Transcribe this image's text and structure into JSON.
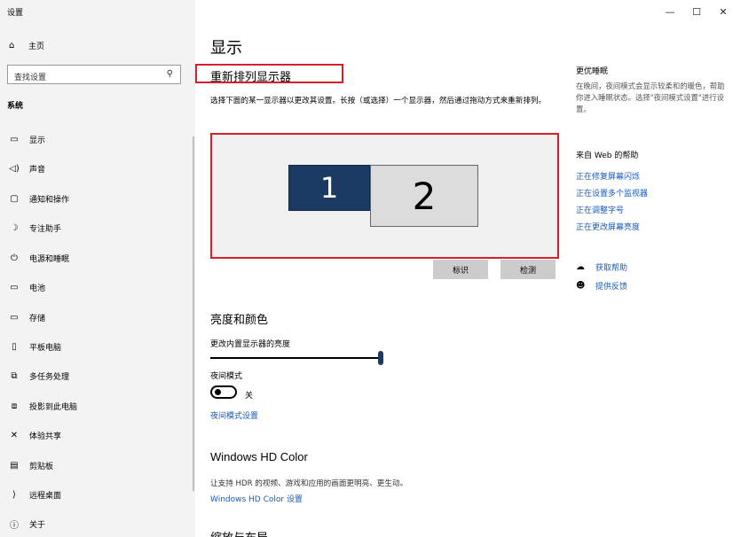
{
  "window": {
    "title": "设置",
    "min_icon": "minimize-icon",
    "max_icon": "maximize-icon",
    "close_icon": "close-icon"
  },
  "sidebar": {
    "home_label": "主页",
    "search_placeholder": "查找设置",
    "section_label": "系统",
    "items": [
      {
        "label": "显示",
        "icon": "monitor-icon"
      },
      {
        "label": "声音",
        "icon": "speaker-icon"
      },
      {
        "label": "通知和操作",
        "icon": "notification-icon"
      },
      {
        "label": "专注助手",
        "icon": "moon-icon"
      },
      {
        "label": "电源和睡眠",
        "icon": "power-icon"
      },
      {
        "label": "电池",
        "icon": "battery-icon"
      },
      {
        "label": "存储",
        "icon": "storage-icon"
      },
      {
        "label": "平板电脑",
        "icon": "tablet-icon"
      },
      {
        "label": "多任务处理",
        "icon": "multitask-icon"
      },
      {
        "label": "投影到此电脑",
        "icon": "project-icon"
      },
      {
        "label": "体验共享",
        "icon": "share-icon"
      },
      {
        "label": "剪贴板",
        "icon": "clipboard-icon"
      },
      {
        "label": "远程桌面",
        "icon": "remote-desktop-icon"
      },
      {
        "label": "关于",
        "icon": "info-icon"
      }
    ]
  },
  "main": {
    "title": "显示",
    "rearrange_heading": "重新排列显示器",
    "rearrange_desc": "选择下面的某一显示器以更改其设置。长按（或选择）一个显示器，然后通过拖动方式来重新排列。",
    "monitors": [
      "1",
      "2"
    ],
    "identify_button": "标识",
    "detect_button": "检测",
    "brightness_heading": "亮度和颜色",
    "brightness_label": "更改内置显示器的亮度",
    "brightness_value": 1.0,
    "night_light_label": "夜间模式",
    "night_light_state": "关",
    "night_light_link": "夜间模式设置",
    "hd_heading": "Windows HD Color",
    "hd_desc": "让支持 HDR 的视频、游戏和应用的画面更明亮、更生动。",
    "hd_link": "Windows HD Color 设置",
    "scale_heading": "缩放与布局"
  },
  "right": {
    "sleep_heading": "更优睡眠",
    "sleep_text": "在晚间，夜间模式会显示较柔和的暖色，帮助你进入睡眠状态。选择\"夜间模式设置\"进行设置。",
    "web_help_heading": "来自 Web 的帮助",
    "links": [
      "正在修复屏幕闪烁",
      "正在设置多个监视器",
      "正在调整字号",
      "正在更改屏幕亮度"
    ],
    "get_help": "获取帮助",
    "feedback": "提供反馈"
  }
}
